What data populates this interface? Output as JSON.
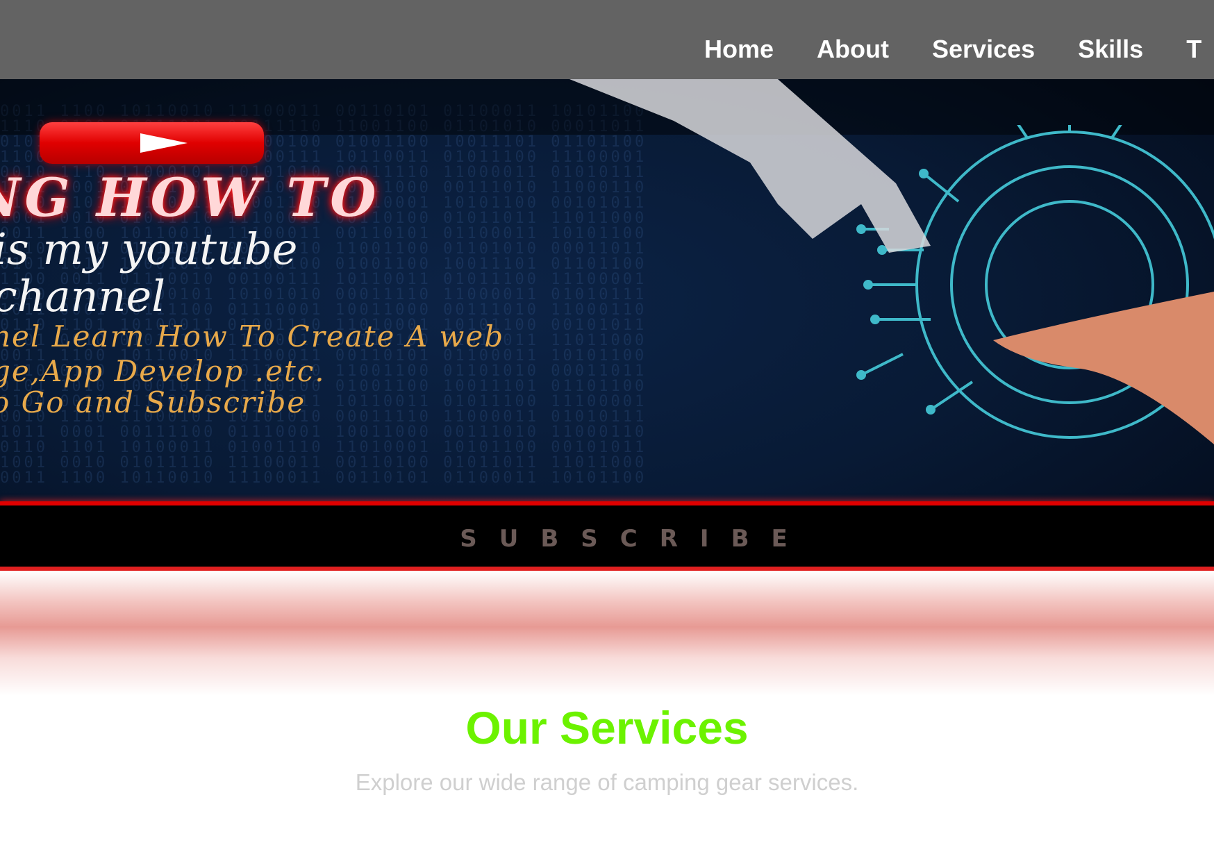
{
  "nav": {
    "items": [
      {
        "label": "Home"
      },
      {
        "label": "About"
      },
      {
        "label": "Services"
      },
      {
        "label": "Skills"
      },
      {
        "label": "T"
      }
    ]
  },
  "hero": {
    "title": "NG HOW  TO",
    "line1": "is my youtube",
    "line2": "channel",
    "line3": "nel Learn How To Create A web",
    "line4": "ge,App Develop .etc.",
    "line5": "o Go and Subscribe",
    "subscribe": "SUBSCRIBE"
  },
  "services": {
    "title": "Our Services",
    "subtitle": "Explore our wide range of camping gear services."
  },
  "colors": {
    "header": "#636363",
    "accent": "#6cf200",
    "youtube_red": "#e00000",
    "gold": "#e8a94a"
  }
}
